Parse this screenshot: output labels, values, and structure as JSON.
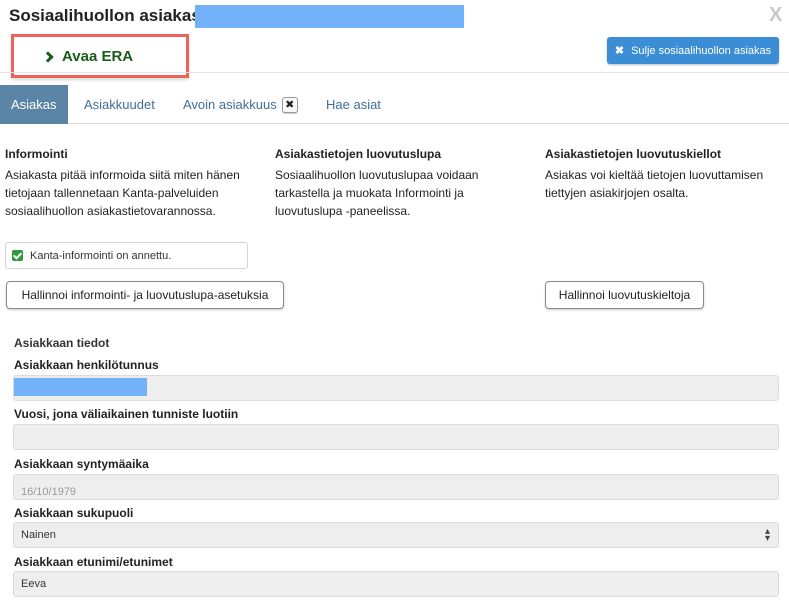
{
  "header": {
    "title": "Sosiaalihuollon asiakas :",
    "close_glyph": "X"
  },
  "era": {
    "label": "Avaa ERA"
  },
  "close_client_button": {
    "label": "Sulje sosiaalihuollon asiakas",
    "icon": "✖"
  },
  "tabs": [
    {
      "label": "Asiakas",
      "active": true
    },
    {
      "label": "Asiakkuudet",
      "active": false
    },
    {
      "label": "Avoin asiakkuus",
      "active": false,
      "closable": true,
      "close_glyph": "✖"
    },
    {
      "label": "Hae asiat",
      "active": false
    }
  ],
  "columns": {
    "informointi": {
      "title": "Informointi",
      "text": "Asiakasta pitää informoida siitä miten hänen tietojaan tallennetaan Kanta-palveluiden sosiaalihuollon asiakastietovarannossa."
    },
    "luovutuslupa": {
      "title": "Asiakastietojen luovutuslupa",
      "text": "Sosiaalihuollon luovutuslupaa voidaan tarkastella ja muokata Informointi ja luovutuslupa -paneelissa."
    },
    "luovutuskiellot": {
      "title": "Asiakastietojen luovutuskiellot",
      "text": "Asiakas voi kieltää tietojen luovuttamisen tiettyjen asiakirjojen osalta."
    }
  },
  "kanta_checkbox": {
    "label": "Kanta-informointi on annettu.",
    "checked": true
  },
  "buttons": {
    "manage_informing": "Hallinnoi informointi- ja luovutuslupa-asetuksia",
    "manage_prohibitions": "Hallinnoi luovutuskieltoja"
  },
  "client_info": {
    "section_title": "Asiakkaan tiedot",
    "fields": [
      {
        "label": "Asiakkaan henkilötunnus",
        "value": ""
      },
      {
        "label": "Vuosi, jona väliaikainen tunniste luotiin",
        "value": ""
      },
      {
        "label": "Asiakkaan syntymäaika",
        "value": "16/10/1979"
      },
      {
        "label": "Asiakkaan sukupuoli",
        "value": "Nainen"
      },
      {
        "label": "Asiakkaan etunimi/etunimet",
        "value": "Eeva"
      }
    ]
  },
  "colors": {
    "accent_blue": "#3b8ed6",
    "active_tab": "#5b85a6",
    "era_border": "#ee6358",
    "era_text": "#1a5a1a",
    "redaction": "#73b2f8"
  }
}
